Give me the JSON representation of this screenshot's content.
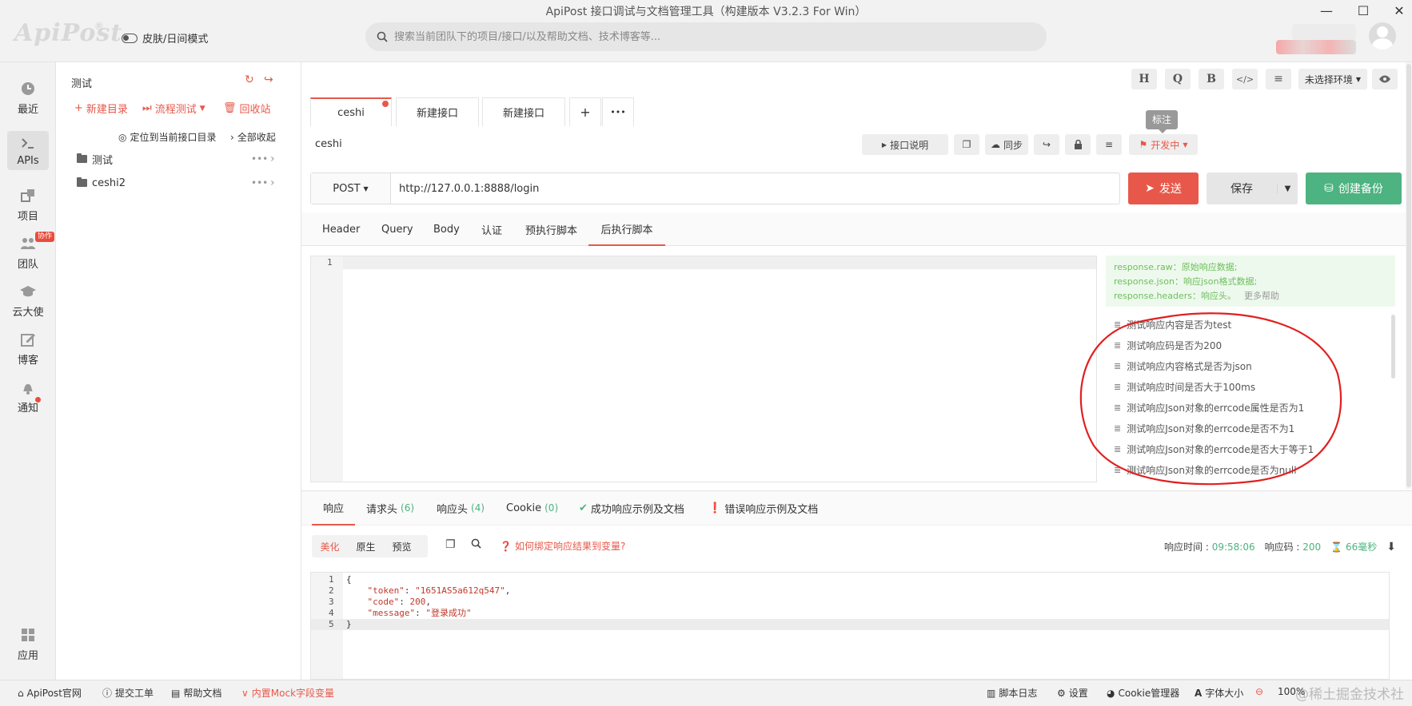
{
  "app": {
    "title": "ApiPost 接口调试与文档管理工具（构建版本 V3.2.3 For Win）",
    "logo": "ApiPost",
    "logo_mark": "®",
    "skin_toggle": "皮肤/日间模式",
    "search_placeholder": "搜索当前团队下的项目/接口/以及帮助文档、技术博客等...",
    "window_buttons": [
      "—",
      "☐",
      "✕"
    ]
  },
  "nav": {
    "items": [
      {
        "label": "最近",
        "icon": "clock-icon"
      },
      {
        "label": "APIs",
        "icon": "terminal-icon"
      },
      {
        "label": "项目",
        "icon": "project-icon"
      },
      {
        "label": "团队",
        "icon": "team-icon"
      },
      {
        "label": "云大使",
        "icon": "graduation-cap-icon"
      },
      {
        "label": "博客",
        "icon": "edit-icon"
      },
      {
        "label": "通知",
        "icon": "bell-icon"
      },
      {
        "label": "应用",
        "icon": "apps-grid-icon"
      }
    ],
    "team_badge": "协作"
  },
  "tree": {
    "title": "测试",
    "actions": {
      "new_dir": "新建目录",
      "flow_test": "流程测试",
      "recycle": "回收站"
    },
    "locate": "定位到当前接口目录",
    "collapse": "全部收起",
    "folders": [
      "测试",
      "ceshi2"
    ],
    "more": "•••"
  },
  "toolbar": {
    "buttons": [
      "H",
      "Q",
      "B",
      "</>",
      "≡"
    ],
    "env": "未选择环境",
    "tooltip": "标注"
  },
  "tabs": [
    {
      "label": "ceshi"
    },
    {
      "label": "新建接口"
    },
    {
      "label": "新建接口"
    },
    {
      "label": "+"
    },
    {
      "label": "•••"
    }
  ],
  "api": {
    "name": "ceshi",
    "doc_btn": "接口说明",
    "sync_btn": "同步",
    "status": "开发中",
    "method": "POST",
    "url": "http://127.0.0.1:8888/login",
    "send": "发送",
    "save": "保存",
    "backup": "创建备份"
  },
  "req_tabs": [
    "Header",
    "Query",
    "Body",
    "认证",
    "预执行脚本",
    "后执行脚本"
  ],
  "editor": {
    "line": "1"
  },
  "hints": {
    "line1_key": "response.raw",
    "line1_val": "原始响应数据;",
    "line2_key": "response.json",
    "line2_val": "响应json格式数据;",
    "line3_key": "response.headers",
    "line3_val": "响应头。",
    "more": "更多帮助"
  },
  "snippets": [
    "测试响应内容是否为test",
    "测试响应码是否为200",
    "测试响应内容格式是否为json",
    "测试响应时间是否大于100ms",
    "测试响应Json对象的errcode属性是否为1",
    "测试响应Json对象的errcode是否不为1",
    "测试响应Json对象的errcode是否大于等于1",
    "测试响应Json对象的errcode是否为null"
  ],
  "resp_tabs": {
    "response": "响应",
    "req_headers": "请求头",
    "req_headers_count": "(6)",
    "resp_headers": "响应头",
    "resp_headers_count": "(4)",
    "cookie": "Cookie",
    "cookie_count": "(0)",
    "success_doc": "成功响应示例及文档",
    "error_doc": "错误响应示例及文档"
  },
  "resp_tools": {
    "pretty": "美化",
    "raw": "原生",
    "preview": "预览",
    "bind_help": "如何绑定响应结果到变量?"
  },
  "resp_stats": {
    "time_label": "响应时间 :",
    "time_val": "09:58:06",
    "code_label": "响应码 :",
    "code_val": "200",
    "duration": "66毫秒"
  },
  "resp_code": [
    {
      "ln": "1",
      "text": "{"
    },
    {
      "ln": "2",
      "key": "\"token\"",
      "val": "\"1651AS5a612q547\"",
      "tail": ","
    },
    {
      "ln": "3",
      "key": "\"code\"",
      "val": "200",
      "tail": ","
    },
    {
      "ln": "4",
      "key": "\"message\"",
      "val": "\"登录成功\"",
      "tail": ""
    },
    {
      "ln": "5",
      "text": "}"
    }
  ],
  "bottom": {
    "official": "ApiPost官网",
    "ticket": "提交工单",
    "help": "帮助文档",
    "mock": "内置Mock字段变量",
    "script_log": "脚本日志",
    "settings": "设置",
    "cookie_mgr": "Cookie管理器",
    "font_size": "字体大小",
    "zoom": "100%",
    "watermark": "@稀土掘金技术社区"
  },
  "colors": {
    "accent": "#e8584a",
    "green": "#4db380",
    "hint_bg": "#eef9ee"
  }
}
